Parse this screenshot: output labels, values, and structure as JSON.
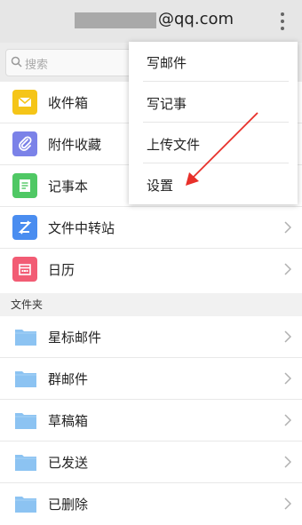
{
  "header": {
    "email_domain": "@qq.com",
    "more_icon": "more-vertical-icon"
  },
  "search": {
    "placeholder": "搜索",
    "icon": "search-icon"
  },
  "apps": [
    {
      "label": "收件箱",
      "icon": "inbox-icon",
      "color": "#F5C518"
    },
    {
      "label": "附件收藏",
      "icon": "attachment-icon",
      "color": "#7B82E8"
    },
    {
      "label": "记事本",
      "icon": "notepad-icon",
      "color": "#4FC864"
    },
    {
      "label": "文件中转站",
      "icon": "transfer-icon",
      "color": "#4A8DF0"
    },
    {
      "label": "日历",
      "icon": "calendar-icon",
      "color": "#F25C74"
    }
  ],
  "folders_section": {
    "label": "文件夹"
  },
  "folders": [
    {
      "label": "星标邮件"
    },
    {
      "label": "群邮件"
    },
    {
      "label": "草稿箱"
    },
    {
      "label": "已发送"
    },
    {
      "label": "已删除"
    }
  ],
  "menu": {
    "items": [
      {
        "label": "写邮件"
      },
      {
        "label": "写记事"
      },
      {
        "label": "上传文件"
      },
      {
        "label": "设置"
      }
    ]
  },
  "colors": {
    "folder": "#8CC3F2",
    "arrow": "#E8302A",
    "header_bg": "#E6E6E6"
  }
}
